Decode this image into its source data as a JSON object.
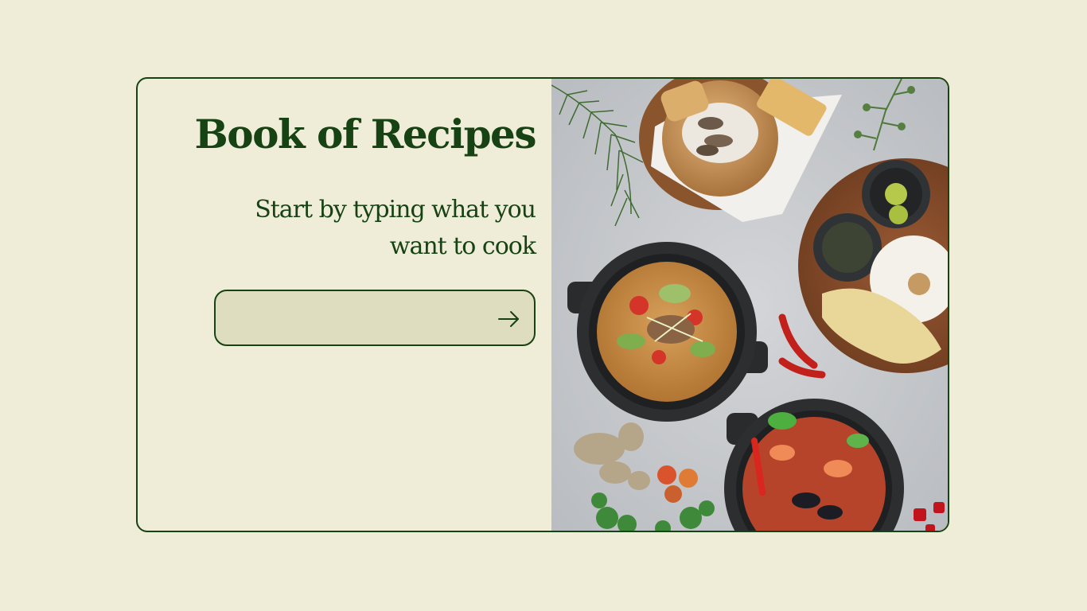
{
  "hero": {
    "title": "Book of Recipes",
    "subtitle": "Start by typing what you want to cook"
  },
  "search": {
    "placeholder": "",
    "value": "",
    "submit_icon": "arrow-right-icon"
  },
  "image": {
    "subject": "food-photo"
  },
  "colors": {
    "background": "#efecd8",
    "accent": "#174213",
    "input_bg": "#dfddbf"
  }
}
